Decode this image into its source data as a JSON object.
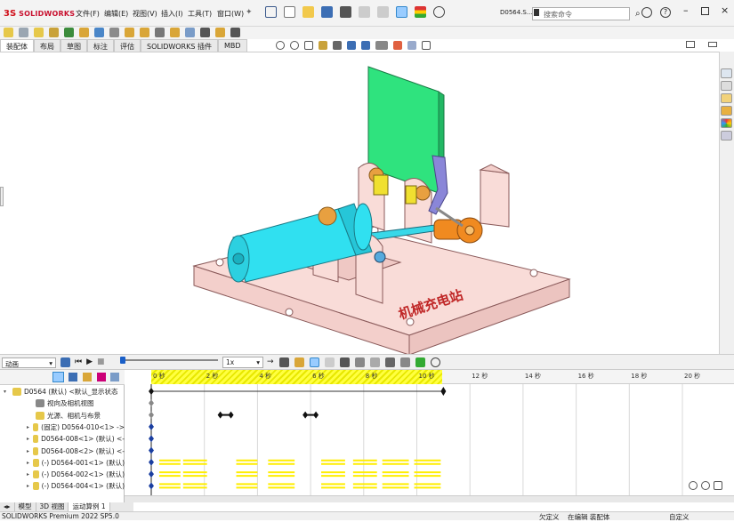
{
  "app": {
    "brand": "SOLIDWORKS",
    "doc": "D0564.S...",
    "search_placeholder": "搜索命令"
  },
  "menus": [
    "文件(F)",
    "编辑(E)",
    "视图(V)",
    "插入(I)",
    "工具(T)",
    "窗口(W)"
  ],
  "tabs": [
    "装配体",
    "布局",
    "草图",
    "标注",
    "评估",
    "SOLIDWORKS 插件",
    "MBD"
  ],
  "motion": {
    "study_type": "动画",
    "speed": "1x"
  },
  "ruler_labels": [
    "0 秒",
    "2 秒",
    "4 秒",
    "6 秒",
    "8 秒",
    "10 秒",
    "12 秒",
    "14 秒",
    "16 秒",
    "18 秒",
    "20 秒"
  ],
  "tree": [
    {
      "label": "D0564 (默认) <默认_显示状态",
      "level": 0,
      "icon": "assembly-icon"
    },
    {
      "label": "视向及相机视图",
      "level": 1,
      "icon": "camera-icon"
    },
    {
      "label": "光源、相机与布景",
      "level": 1,
      "icon": "light-icon"
    },
    {
      "label": "(固定) D0564-010<1> ->",
      "level": 1,
      "icon": "part-icon"
    },
    {
      "label": "D0564-008<1> (默认) <-",
      "level": 1,
      "icon": "part-icon"
    },
    {
      "label": "D0564-008<2> (默认) <-",
      "level": 1,
      "icon": "part-icon"
    },
    {
      "label": "(-) D0564-001<1> (默认)",
      "level": 1,
      "icon": "part-icon"
    },
    {
      "label": "(-) D0564-002<1> (默认)",
      "level": 1,
      "icon": "part-icon"
    },
    {
      "label": "(-) D0564-004<1> (默认)",
      "level": 1,
      "icon": "part-icon"
    }
  ],
  "watermark": "机械充电站",
  "bottom_tabs": [
    "模型",
    "3D 视图",
    "运动算例 1"
  ],
  "status": {
    "left": "SOLIDWORKS Premium 2022 SP5.0",
    "center1": "欠定义",
    "center2": "在编辑 装配体",
    "right": "自定义"
  }
}
